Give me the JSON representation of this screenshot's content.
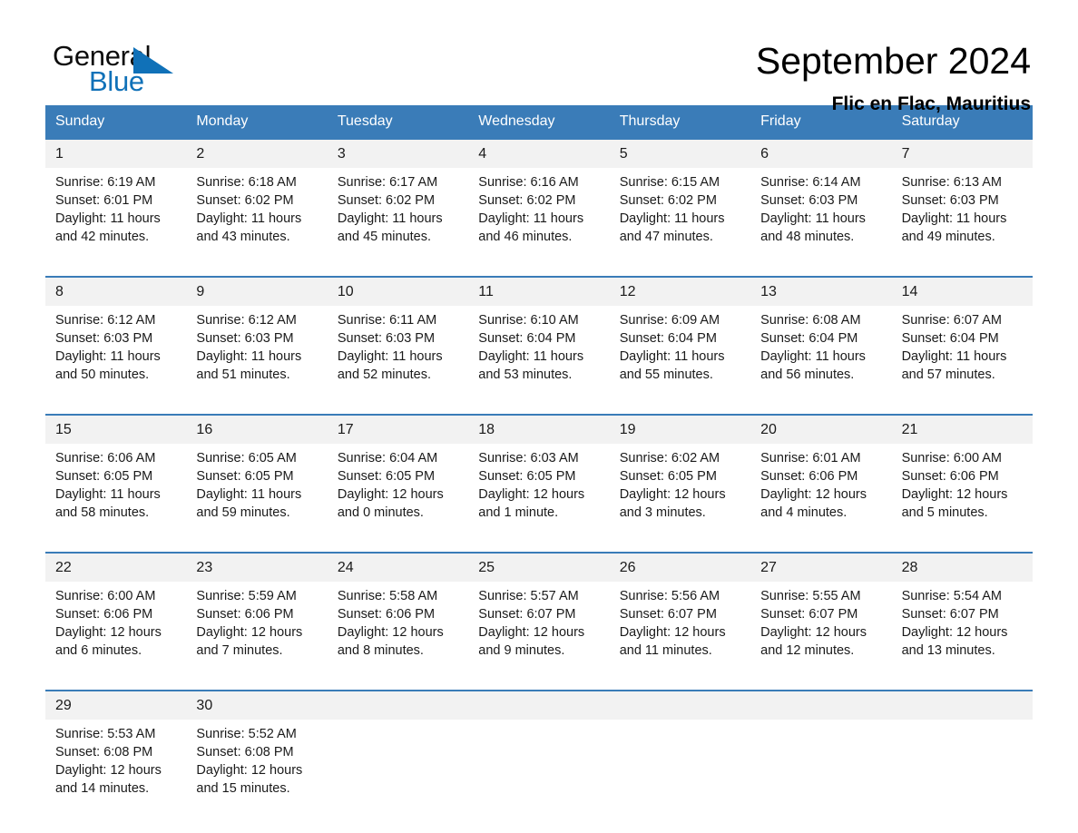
{
  "brand": {
    "name_dark": "General",
    "name_light": "Blue",
    "accent_color": "#1071b8"
  },
  "header": {
    "title": "September 2024",
    "subtitle": "Flic en Flac, Mauritius"
  },
  "calendar": {
    "header_bg": "#3a7cb8",
    "daynum_bg": "#f2f2f2",
    "weekdays": [
      "Sunday",
      "Monday",
      "Tuesday",
      "Wednesday",
      "Thursday",
      "Friday",
      "Saturday"
    ],
    "weeks": [
      {
        "days": [
          {
            "date": "1",
            "sunrise": "Sunrise: 6:19 AM",
            "sunset": "Sunset: 6:01 PM",
            "daylight": "Daylight: 11 hours and 42 minutes."
          },
          {
            "date": "2",
            "sunrise": "Sunrise: 6:18 AM",
            "sunset": "Sunset: 6:02 PM",
            "daylight": "Daylight: 11 hours and 43 minutes."
          },
          {
            "date": "3",
            "sunrise": "Sunrise: 6:17 AM",
            "sunset": "Sunset: 6:02 PM",
            "daylight": "Daylight: 11 hours and 45 minutes."
          },
          {
            "date": "4",
            "sunrise": "Sunrise: 6:16 AM",
            "sunset": "Sunset: 6:02 PM",
            "daylight": "Daylight: 11 hours and 46 minutes."
          },
          {
            "date": "5",
            "sunrise": "Sunrise: 6:15 AM",
            "sunset": "Sunset: 6:02 PM",
            "daylight": "Daylight: 11 hours and 47 minutes."
          },
          {
            "date": "6",
            "sunrise": "Sunrise: 6:14 AM",
            "sunset": "Sunset: 6:03 PM",
            "daylight": "Daylight: 11 hours and 48 minutes."
          },
          {
            "date": "7",
            "sunrise": "Sunrise: 6:13 AM",
            "sunset": "Sunset: 6:03 PM",
            "daylight": "Daylight: 11 hours and 49 minutes."
          }
        ]
      },
      {
        "days": [
          {
            "date": "8",
            "sunrise": "Sunrise: 6:12 AM",
            "sunset": "Sunset: 6:03 PM",
            "daylight": "Daylight: 11 hours and 50 minutes."
          },
          {
            "date": "9",
            "sunrise": "Sunrise: 6:12 AM",
            "sunset": "Sunset: 6:03 PM",
            "daylight": "Daylight: 11 hours and 51 minutes."
          },
          {
            "date": "10",
            "sunrise": "Sunrise: 6:11 AM",
            "sunset": "Sunset: 6:03 PM",
            "daylight": "Daylight: 11 hours and 52 minutes."
          },
          {
            "date": "11",
            "sunrise": "Sunrise: 6:10 AM",
            "sunset": "Sunset: 6:04 PM",
            "daylight": "Daylight: 11 hours and 53 minutes."
          },
          {
            "date": "12",
            "sunrise": "Sunrise: 6:09 AM",
            "sunset": "Sunset: 6:04 PM",
            "daylight": "Daylight: 11 hours and 55 minutes."
          },
          {
            "date": "13",
            "sunrise": "Sunrise: 6:08 AM",
            "sunset": "Sunset: 6:04 PM",
            "daylight": "Daylight: 11 hours and 56 minutes."
          },
          {
            "date": "14",
            "sunrise": "Sunrise: 6:07 AM",
            "sunset": "Sunset: 6:04 PM",
            "daylight": "Daylight: 11 hours and 57 minutes."
          }
        ]
      },
      {
        "days": [
          {
            "date": "15",
            "sunrise": "Sunrise: 6:06 AM",
            "sunset": "Sunset: 6:05 PM",
            "daylight": "Daylight: 11 hours and 58 minutes."
          },
          {
            "date": "16",
            "sunrise": "Sunrise: 6:05 AM",
            "sunset": "Sunset: 6:05 PM",
            "daylight": "Daylight: 11 hours and 59 minutes."
          },
          {
            "date": "17",
            "sunrise": "Sunrise: 6:04 AM",
            "sunset": "Sunset: 6:05 PM",
            "daylight": "Daylight: 12 hours and 0 minutes."
          },
          {
            "date": "18",
            "sunrise": "Sunrise: 6:03 AM",
            "sunset": "Sunset: 6:05 PM",
            "daylight": "Daylight: 12 hours and 1 minute."
          },
          {
            "date": "19",
            "sunrise": "Sunrise: 6:02 AM",
            "sunset": "Sunset: 6:05 PM",
            "daylight": "Daylight: 12 hours and 3 minutes."
          },
          {
            "date": "20",
            "sunrise": "Sunrise: 6:01 AM",
            "sunset": "Sunset: 6:06 PM",
            "daylight": "Daylight: 12 hours and 4 minutes."
          },
          {
            "date": "21",
            "sunrise": "Sunrise: 6:00 AM",
            "sunset": "Sunset: 6:06 PM",
            "daylight": "Daylight: 12 hours and 5 minutes."
          }
        ]
      },
      {
        "days": [
          {
            "date": "22",
            "sunrise": "Sunrise: 6:00 AM",
            "sunset": "Sunset: 6:06 PM",
            "daylight": "Daylight: 12 hours and 6 minutes."
          },
          {
            "date": "23",
            "sunrise": "Sunrise: 5:59 AM",
            "sunset": "Sunset: 6:06 PM",
            "daylight": "Daylight: 12 hours and 7 minutes."
          },
          {
            "date": "24",
            "sunrise": "Sunrise: 5:58 AM",
            "sunset": "Sunset: 6:06 PM",
            "daylight": "Daylight: 12 hours and 8 minutes."
          },
          {
            "date": "25",
            "sunrise": "Sunrise: 5:57 AM",
            "sunset": "Sunset: 6:07 PM",
            "daylight": "Daylight: 12 hours and 9 minutes."
          },
          {
            "date": "26",
            "sunrise": "Sunrise: 5:56 AM",
            "sunset": "Sunset: 6:07 PM",
            "daylight": "Daylight: 12 hours and 11 minutes."
          },
          {
            "date": "27",
            "sunrise": "Sunrise: 5:55 AM",
            "sunset": "Sunset: 6:07 PM",
            "daylight": "Daylight: 12 hours and 12 minutes."
          },
          {
            "date": "28",
            "sunrise": "Sunrise: 5:54 AM",
            "sunset": "Sunset: 6:07 PM",
            "daylight": "Daylight: 12 hours and 13 minutes."
          }
        ]
      },
      {
        "days": [
          {
            "date": "29",
            "sunrise": "Sunrise: 5:53 AM",
            "sunset": "Sunset: 6:08 PM",
            "daylight": "Daylight: 12 hours and 14 minutes."
          },
          {
            "date": "30",
            "sunrise": "Sunrise: 5:52 AM",
            "sunset": "Sunset: 6:08 PM",
            "daylight": "Daylight: 12 hours and 15 minutes."
          },
          {
            "date": "",
            "sunrise": "",
            "sunset": "",
            "daylight": ""
          },
          {
            "date": "",
            "sunrise": "",
            "sunset": "",
            "daylight": ""
          },
          {
            "date": "",
            "sunrise": "",
            "sunset": "",
            "daylight": ""
          },
          {
            "date": "",
            "sunrise": "",
            "sunset": "",
            "daylight": ""
          },
          {
            "date": "",
            "sunrise": "",
            "sunset": "",
            "daylight": ""
          }
        ]
      }
    ]
  }
}
